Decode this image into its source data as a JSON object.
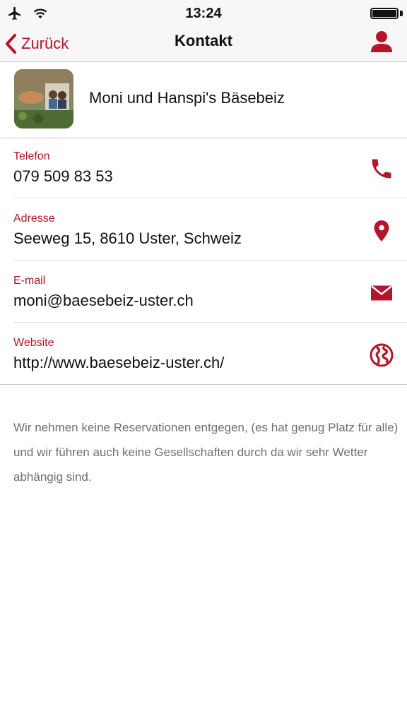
{
  "status": {
    "time": "13:24",
    "icons": [
      "airplane-icon",
      "wifi-icon",
      "battery-icon"
    ]
  },
  "nav": {
    "back_label": "Zurück",
    "title": "Kontakt",
    "profile_icon": "person-icon"
  },
  "contact": {
    "name": "Moni und Hanspi's Bäsebeiz",
    "rows": [
      {
        "label": "Telefon",
        "value": "079 509 83 53",
        "icon": "phone-icon"
      },
      {
        "label": "Adresse",
        "value": "Seeweg 15, 8610 Uster, Schweiz",
        "icon": "map-pin-icon"
      },
      {
        "label": "E-mail",
        "value": "moni@baesebeiz-uster.ch",
        "icon": "mail-icon"
      },
      {
        "label": "Website",
        "value": "http://www.baesebeiz-uster.ch/",
        "icon": "globe-icon"
      }
    ]
  },
  "description": "Wir nehmen keine Reservationen entgegen, (es hat genug Platz für alle) und wir führen auch keine Gesellschaften durch da wir sehr Wetter abhängig sind.",
  "colors": {
    "accent": "#b3162a",
    "bar_background": "#f7f7f7",
    "description_text": "#6f6f6f"
  }
}
